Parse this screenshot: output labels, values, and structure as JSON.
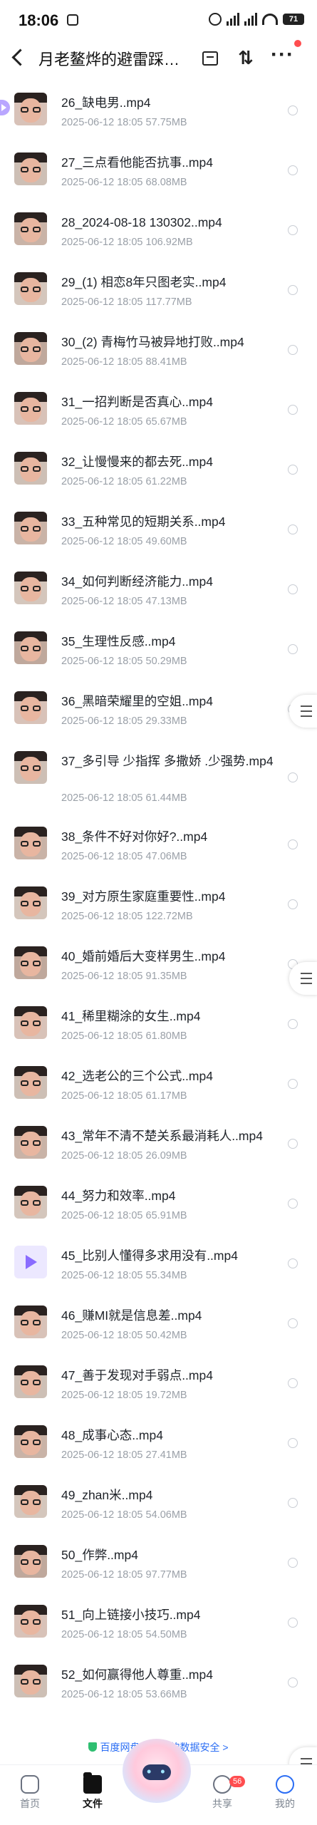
{
  "status_bar": {
    "time": "18:06",
    "battery": "71"
  },
  "header": {
    "title": "月老鳌烨的避雷踩…"
  },
  "files": [
    {
      "name": "26_缺电男..mp4",
      "date": "2025-06-12",
      "time": "18:05",
      "size": "57.75MB"
    },
    {
      "name": "27_三点看他能否抗事..mp4",
      "date": "2025-06-12",
      "time": "18:05",
      "size": "68.08MB"
    },
    {
      "name": "28_2024-08-18 130302..mp4",
      "date": "2025-06-12",
      "time": "18:05",
      "size": "106.92MB"
    },
    {
      "name": "29_(1) 相恋8年只图老实..mp4",
      "date": "2025-06-12",
      "time": "18:05",
      "size": "117.77MB"
    },
    {
      "name": "30_(2) 青梅竹马被异地打败..mp4",
      "date": "2025-06-12",
      "time": "18:05",
      "size": "88.41MB"
    },
    {
      "name": "31_一招判断是否真心..mp4",
      "date": "2025-06-12",
      "time": "18:05",
      "size": "65.67MB"
    },
    {
      "name": "32_让慢慢来的都去死..mp4",
      "date": "2025-06-12",
      "time": "18:05",
      "size": "61.22MB"
    },
    {
      "name": "33_五种常见的短期关系..mp4",
      "date": "2025-06-12",
      "time": "18:05",
      "size": "49.60MB"
    },
    {
      "name": "34_如何判断经济能力..mp4",
      "date": "2025-06-12",
      "time": "18:05",
      "size": "47.13MB"
    },
    {
      "name": "35_生理性反感..mp4",
      "date": "2025-06-12",
      "time": "18:05",
      "size": "50.29MB"
    },
    {
      "name": "36_黑暗荣耀里的空姐..mp4",
      "date": "2025-06-12",
      "time": "18:05",
      "size": "29.33MB"
    },
    {
      "name": "37_多引导 少指挥 多撒娇 .少强势.mp4",
      "date": "2025-06-12",
      "time": "18:05",
      "size": "61.44MB"
    },
    {
      "name": "38_条件不好对你好?..mp4",
      "date": "2025-06-12",
      "time": "18:05",
      "size": "47.06MB"
    },
    {
      "name": "39_对方原生家庭重要性..mp4",
      "date": "2025-06-12",
      "time": "18:05",
      "size": "122.72MB"
    },
    {
      "name": "40_婚前婚后大变样男生..mp4",
      "date": "2025-06-12",
      "time": "18:05",
      "size": "91.35MB"
    },
    {
      "name": "41_稀里糊涂的女生..mp4",
      "date": "2025-06-12",
      "time": "18:05",
      "size": "61.80MB"
    },
    {
      "name": "42_选老公的三个公式..mp4",
      "date": "2025-06-12",
      "time": "18:05",
      "size": "61.17MB"
    },
    {
      "name": "43_常年不清不楚关系最消耗人..mp4",
      "date": "2025-06-12",
      "time": "18:05",
      "size": "26.09MB"
    },
    {
      "name": "44_努力和效率..mp4",
      "date": "2025-06-12",
      "time": "18:05",
      "size": "65.91MB"
    },
    {
      "name": "45_比别人懂得多求用没有..mp4",
      "date": "2025-06-12",
      "time": "18:05",
      "size": "55.34MB"
    },
    {
      "name": "46_赚MI就是信息差..mp4",
      "date": "2025-06-12",
      "time": "18:05",
      "size": "50.42MB"
    },
    {
      "name": "47_善于发现对手弱点..mp4",
      "date": "2025-06-12",
      "time": "18:05",
      "size": "19.72MB"
    },
    {
      "name": "48_成事心态..mp4",
      "date": "2025-06-12",
      "time": "18:05",
      "size": "27.41MB"
    },
    {
      "name": "49_zhan米..mp4",
      "date": "2025-06-12",
      "time": "18:05",
      "size": "54.06MB"
    },
    {
      "name": "50_作弊..mp4",
      "date": "2025-06-12",
      "time": "18:05",
      "size": "97.77MB"
    },
    {
      "name": "51_向上链接小技巧..mp4",
      "date": "2025-06-12",
      "time": "18:05",
      "size": "54.50MB"
    },
    {
      "name": "52_如何赢得他人尊重..mp4",
      "date": "2025-06-12",
      "time": "18:05",
      "size": "53.66MB"
    }
  ],
  "protection_notice": "百度网盘保障你的数据安全 >",
  "tabbar": {
    "home": "首页",
    "files": "文件",
    "share": "共享",
    "share_badge": "56",
    "me": "我的"
  }
}
